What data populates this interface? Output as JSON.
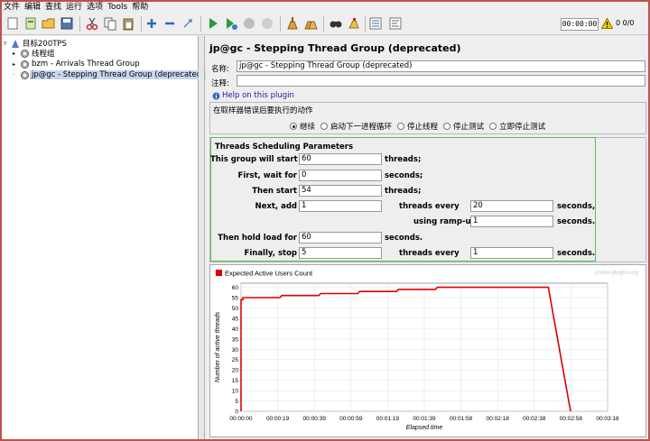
{
  "menu": [
    "文件",
    "编辑",
    "查找",
    "运行",
    "选项",
    "Tools",
    "帮助"
  ],
  "toolbar": {
    "icons": [
      "new-icon",
      "templates-icon",
      "open-icon",
      "save-icon",
      "cut-icon",
      "copy-icon",
      "paste-icon",
      "expand-icon",
      "collapse-icon",
      "toggle-icon",
      "start-icon",
      "start-no-pause-icon",
      "stop-icon",
      "shutdown-icon",
      "clear-icon",
      "clear-all-icon",
      "search-icon",
      "reset-search-icon",
      "function-helper-icon",
      "help-icon"
    ],
    "timer": "00:00:00",
    "counts": "0 0/0"
  },
  "tree": {
    "root": "目标200TPS",
    "items": [
      "线程组",
      "bzm - Arrivals Thread Group",
      "jp@gc - Stepping Thread Group (deprecated)"
    ]
  },
  "panel": {
    "title": "jp@gc - Stepping Thread Group (deprecated)",
    "name_label": "名称:",
    "name_value": "jp@gc - Stepping Thread Group (deprecated)",
    "comment_label": "注释:",
    "comment_value": "",
    "help_link": "Help on this plugin",
    "error_action_title": "在取样器错误后要执行的动作",
    "error_options": [
      "继续",
      "启动下一进程循环",
      "停止线程",
      "停止测试",
      "立即停止测试"
    ],
    "selected_error_option": "继续"
  },
  "params": {
    "title": "Threads Scheduling Parameters",
    "this_group_label": "This group will start",
    "this_group_value": "60",
    "threads_unit": "threads;",
    "first_wait_label": "First, wait for",
    "first_wait_value": "0",
    "seconds_unit": "seconds;",
    "then_start_label": "Then start",
    "then_start_value": "54",
    "next_add_label": "Next, add",
    "next_add_value": "1",
    "threads_every_label": "threads every",
    "threads_every_value": "20",
    "seconds_comma": "seconds,",
    "ramp_up_label": "using ramp-up",
    "ramp_up_value": "1",
    "seconds_dot": "seconds.",
    "hold_label": "Then hold load for",
    "hold_value": "60",
    "stop_label": "Finally, stop",
    "stop_value": "5",
    "stop_every_label": "threads every",
    "stop_every_value": "1"
  },
  "chart_data": {
    "type": "line",
    "legend": "Expected Active Users Count",
    "watermark": "jmeter-plugins.org",
    "xlabel": "Elapsed time",
    "ylabel": "Number of active threads",
    "x_ticks": [
      "00:00:00",
      "00:00:19",
      "00:00:39",
      "00:00:59",
      "00:01:19",
      "00:01:39",
      "00:01:58",
      "00:02:18",
      "00:02:38",
      "00:02:58",
      "00:03:18"
    ],
    "y_ticks": [
      0,
      5,
      10,
      15,
      20,
      25,
      30,
      35,
      40,
      45,
      50,
      55,
      60
    ],
    "xlim": [
      0,
      198
    ],
    "ylim": [
      0,
      62
    ],
    "series_color": "#dd0000",
    "points_seconds": [
      [
        0,
        0
      ],
      [
        0,
        54
      ],
      [
        1,
        54
      ],
      [
        1,
        55
      ],
      [
        21,
        55
      ],
      [
        22,
        56
      ],
      [
        42,
        56
      ],
      [
        43,
        57
      ],
      [
        63,
        57
      ],
      [
        64,
        58
      ],
      [
        84,
        58
      ],
      [
        85,
        59
      ],
      [
        105,
        59
      ],
      [
        106,
        60
      ],
      [
        166,
        60
      ],
      [
        167,
        55
      ],
      [
        168,
        50
      ],
      [
        169,
        45
      ],
      [
        170,
        40
      ],
      [
        171,
        35
      ],
      [
        172,
        30
      ],
      [
        173,
        25
      ],
      [
        174,
        20
      ],
      [
        175,
        15
      ],
      [
        176,
        10
      ],
      [
        177,
        5
      ],
      [
        178,
        0
      ]
    ]
  }
}
